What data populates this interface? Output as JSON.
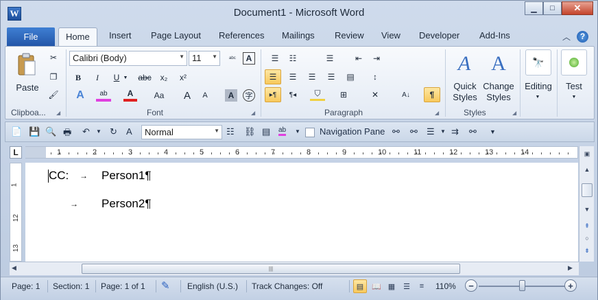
{
  "window": {
    "title": "Document1  -  Microsoft Word",
    "app_icon_letter": "W",
    "controls": {
      "minimize": "▁",
      "maximize": "□",
      "close": "✕"
    }
  },
  "tabs": [
    "File",
    "Home",
    "Insert",
    "Page Layout",
    "References",
    "Mailings",
    "Review",
    "View",
    "Developer",
    "Add-Ins"
  ],
  "active_tab": "Home",
  "ribbon": {
    "clipboard": {
      "paste": "Paste",
      "label": "Clipboa..."
    },
    "font": {
      "name": "Calibri (Body)",
      "size": "11",
      "bold": "B",
      "italic": "I",
      "underline": "U",
      "strike": "abc",
      "subscript": "x₂",
      "superscript": "x²",
      "change_case": "Aa",
      "grow": "A",
      "shrink": "A",
      "label": "Font"
    },
    "paragraph": {
      "label": "Paragraph",
      "show_marks": "¶"
    },
    "styles": {
      "quick_styles": "Quick\nStyles",
      "change_styles": "Change\nStyles",
      "label": "Styles"
    },
    "editing": {
      "label": "Editing"
    },
    "test": {
      "label": "Test"
    }
  },
  "qat": {
    "style_value": "Normal",
    "navigation_pane": "Navigation Pane",
    "navigation_pane_checked": false
  },
  "ruler": {
    "numbers": [
      "1",
      "2",
      "3",
      "4",
      "5",
      "6",
      "7",
      "8",
      "9",
      "10",
      "11",
      "12",
      "13",
      "14"
    ]
  },
  "vruler": {
    "numbers": [
      "1",
      "12",
      "13"
    ]
  },
  "document": {
    "lines": [
      {
        "label": "CC:",
        "text": "Person1¶"
      },
      {
        "label": "",
        "text": "Person2¶"
      }
    ],
    "tab_mark": "→"
  },
  "status": {
    "page": "Page: 1",
    "section": "Section: 1",
    "page_of": "Page: 1 of 1",
    "language": "English (U.S.)",
    "track_changes": "Track Changes: Off",
    "zoom": "110%",
    "zoom_fraction": 0.5
  }
}
